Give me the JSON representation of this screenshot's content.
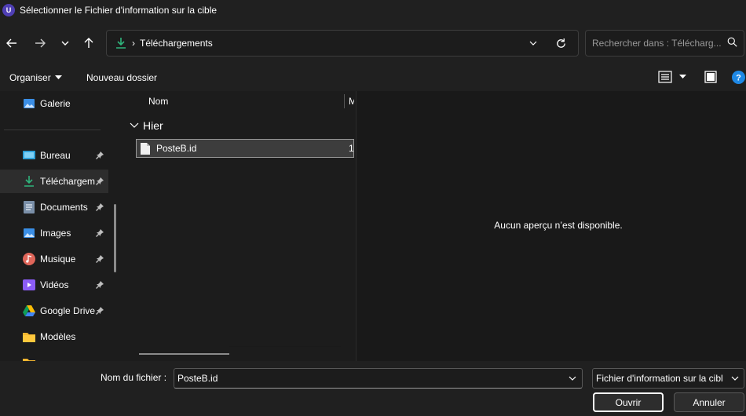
{
  "window": {
    "app_icon_letter": "U",
    "title": "Sélectionner le Fichier d'information sur la cible"
  },
  "nav": {
    "icons": [
      "back-arrow-icon",
      "forward-arrow-icon",
      "chevron-down-icon",
      "up-arrow-icon"
    ]
  },
  "address": {
    "separator": "›",
    "crumb": "Téléchargements"
  },
  "search": {
    "placeholder": "Rechercher dans : Télécharg..."
  },
  "commandbar": {
    "organize_label": "Organiser",
    "new_folder_label": "Nouveau dossier"
  },
  "sidebar": {
    "items": [
      {
        "label": "Galerie",
        "icon": "gallery-icon",
        "pinned": false
      },
      {
        "label": "Bureau",
        "icon": "desktop-icon",
        "pinned": true
      },
      {
        "label": "Téléchargem",
        "icon": "download-icon",
        "pinned": true,
        "active": true
      },
      {
        "label": "Documents",
        "icon": "documents-icon",
        "pinned": true
      },
      {
        "label": "Images",
        "icon": "images-icon",
        "pinned": true
      },
      {
        "label": "Musique",
        "icon": "music-icon",
        "pinned": true
      },
      {
        "label": "Vidéos",
        "icon": "videos-icon",
        "pinned": true
      },
      {
        "label": "Google Drive",
        "icon": "google-drive-icon",
        "pinned": true
      },
      {
        "label": "Modèles",
        "icon": "folder-icon",
        "pinned": false
      }
    ]
  },
  "filelist": {
    "column_name": "Nom",
    "column_next": "M",
    "group_label": "Hier",
    "files": [
      {
        "name": "PosteB.id",
        "col2": "1",
        "selected": true
      }
    ]
  },
  "preview": {
    "message": "Aucun aperçu n’est disponible."
  },
  "bottom": {
    "filename_label": "Nom du fichier :",
    "filename_value": "PosteB.id",
    "filetype_value": "Fichier d'information sur la cibl",
    "open_label": "Ouvrir",
    "cancel_label": "Annuler"
  },
  "colors": {
    "background": "#1c1c1c",
    "chrome": "#202020",
    "accent_green": "#2fb47c",
    "help_blue": "#1e88e5"
  }
}
